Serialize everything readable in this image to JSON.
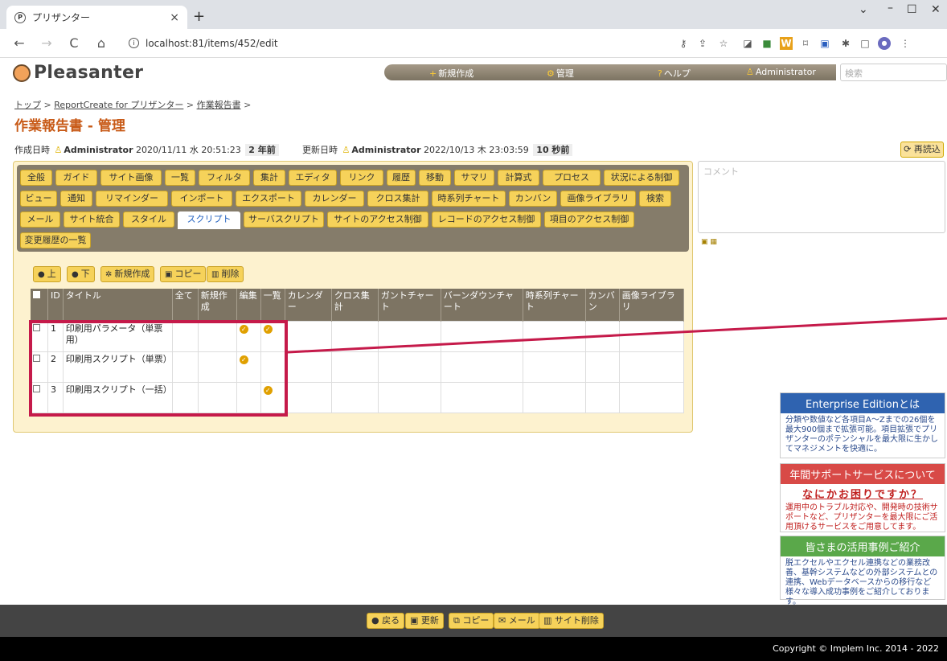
{
  "browser": {
    "tab_title": "プリザンター",
    "favicon": "P",
    "url": "localhost:81/items/452/edit"
  },
  "header": {
    "logo": "Pleasanter",
    "nav": [
      "新規作成",
      "管理",
      "ヘルプ",
      "Administrator"
    ],
    "search_placeholder": "検索"
  },
  "breadcrumb": [
    "トップ",
    "ReportCreate for プリザンター",
    "作業報告書"
  ],
  "page_title": "作業報告書 - 管理",
  "meta": {
    "created_label": "作成日時",
    "created_user": "Administrator",
    "created_at": "2020/11/11 水 20:51:23",
    "created_ago": "2 年前",
    "updated_label": "更新日時",
    "updated_user": "Administrator",
    "updated_at": "2022/10/13 木 23:03:59",
    "updated_ago": "10 秒前",
    "reload": "再読込"
  },
  "tabs": [
    "全般",
    "ガイド",
    "サイト画像",
    "一覧",
    "フィルタ",
    "集計",
    "エディタ",
    "リンク",
    "履歴",
    "移動",
    "サマリ",
    "計算式",
    "プロセス",
    "状況による制御",
    "ビュー",
    "通知",
    "リマインダー",
    "インポート",
    "エクスポート",
    "カレンダー",
    "クロス集計",
    "時系列チャート",
    "カンバン",
    "画像ライブラリ",
    "検索",
    "メール",
    "サイト統合",
    "スタイル",
    "スクリプト",
    "サーバスクリプト",
    "サイトのアクセス制御",
    "レコードのアクセス制御",
    "項目のアクセス制御",
    "変更履歴の一覧"
  ],
  "toolbar": {
    "up": "上",
    "down": "下",
    "new": "新規作成",
    "copy": "コピー",
    "delete": "削除"
  },
  "grid": {
    "columns": [
      "ID",
      "タイトル",
      "全て",
      "新規作成",
      "編集",
      "一覧",
      "カレンダー",
      "クロス集計",
      "ガントチャート",
      "バーンダウンチャート",
      "時系列チャート",
      "カンバン",
      "画像ライブラリ"
    ],
    "rows": [
      {
        "id": "1",
        "title": "印刷用パラメータ（単票用）",
        "edit": true,
        "index": true
      },
      {
        "id": "2",
        "title": "印刷用スクリプト（単票）",
        "edit": true,
        "index": false
      },
      {
        "id": "3",
        "title": "印刷用スクリプト（一括）",
        "edit": false,
        "index": true
      }
    ]
  },
  "comment_placeholder": "コメント",
  "ads": [
    {
      "title": "Enterprise Editionとは",
      "color": "#2f63b0",
      "body": "分類や数値など各項目A～Zまでの26個を最大900個まで拡張可能。項目拡張でプリザンターのポテンシャルを最大限に生かしてマネジメントを快適に。"
    },
    {
      "title": "年間サポートサービスについて",
      "color": "#d84a47",
      "sub": "なにかお困りですか？",
      "body": "運用中のトラブル対応や、開発時の技術サポートなど、プリザンターを最大限にご活用頂けるサービスをご用意してます。"
    },
    {
      "title": "皆さまの活用事例ご紹介",
      "color": "#5aa84a",
      "body": "脱エクセルやエクセル連携などの業務改善、基幹システムなどの外部システムとの連携、Webデータベースからの移行など様々な導入成功事例をご紹介しております。"
    }
  ],
  "footer": {
    "back": "戻る",
    "update": "更新",
    "copy": "コピー",
    "mail": "メール",
    "delete": "サイト削除"
  },
  "copyright": "Copyright © Implem Inc. 2014 - 2022"
}
